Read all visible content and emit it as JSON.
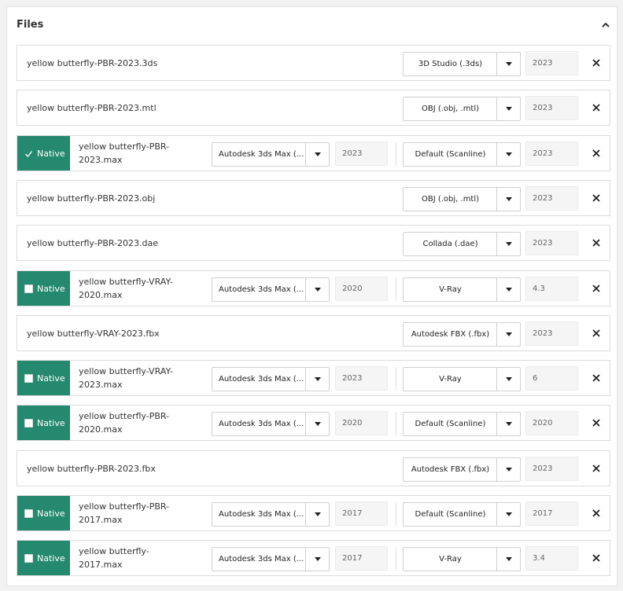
{
  "panel": {
    "title": "Files"
  },
  "rows": [
    {
      "file": "yellow butterfly-PBR-2023.3ds",
      "format": "3D Studio (.3ds)",
      "version": "2023"
    },
    {
      "file": "yellow butterfly-PBR-2023.mtl",
      "format": "OBJ (.obj, .mtl)",
      "version": "2023"
    },
    {
      "file": "yellow butterfly-PBR-2023.max",
      "native": true,
      "native_checked": true,
      "native_label": "Native",
      "app": "Autodesk 3ds Max (...",
      "app_version": "2023",
      "renderer": "Default (Scanline)",
      "renderer_version": "2023"
    },
    {
      "file": "yellow butterfly-PBR-2023.obj",
      "format": "OBJ (.obj, .mtl)",
      "version": "2023"
    },
    {
      "file": "yellow butterfly-PBR-2023.dae",
      "format": "Collada (.dae)",
      "version": "2023"
    },
    {
      "file": "yellow butterfly-VRAY-2020.max",
      "native": true,
      "native_checked": false,
      "native_label": "Native",
      "app": "Autodesk 3ds Max (...",
      "app_version": "2020",
      "renderer": "V-Ray",
      "renderer_version": "4.3"
    },
    {
      "file": "yellow butterfly-VRAY-2023.fbx",
      "format": "Autodesk FBX (.fbx)",
      "version": "2023"
    },
    {
      "file": "yellow butterfly-VRAY-2023.max",
      "native": true,
      "native_checked": false,
      "native_label": "Native",
      "app": "Autodesk 3ds Max (...",
      "app_version": "2023",
      "renderer": "V-Ray",
      "renderer_version": "6"
    },
    {
      "file": "yellow butterfly-PBR-2020.max",
      "native": true,
      "native_checked": false,
      "native_label": "Native",
      "app": "Autodesk 3ds Max (...",
      "app_version": "2020",
      "renderer": "Default (Scanline)",
      "renderer_version": "2020"
    },
    {
      "file": "yellow butterfly-PBR-2023.fbx",
      "format": "Autodesk FBX (.fbx)",
      "version": "2023"
    },
    {
      "file": "yellow butterfly-PBR-2017.max",
      "native": true,
      "native_checked": false,
      "native_label": "Native",
      "app": "Autodesk 3ds Max (...",
      "app_version": "2017",
      "renderer": "Default (Scanline)",
      "renderer_version": "2017"
    },
    {
      "file": "yellow butterfly-2017.max",
      "native": true,
      "native_checked": false,
      "native_label": "Native",
      "app": "Autodesk 3ds Max (...",
      "app_version": "2017",
      "renderer": "V-Ray",
      "renderer_version": "3.4"
    }
  ],
  "colors": {
    "native_bg": "#25896f",
    "border": "#dcdcdc"
  },
  "icons": {
    "collapse": "chevron-up-icon",
    "dropdown": "caret-down-icon",
    "remove": "close-icon",
    "check": "check-icon"
  }
}
